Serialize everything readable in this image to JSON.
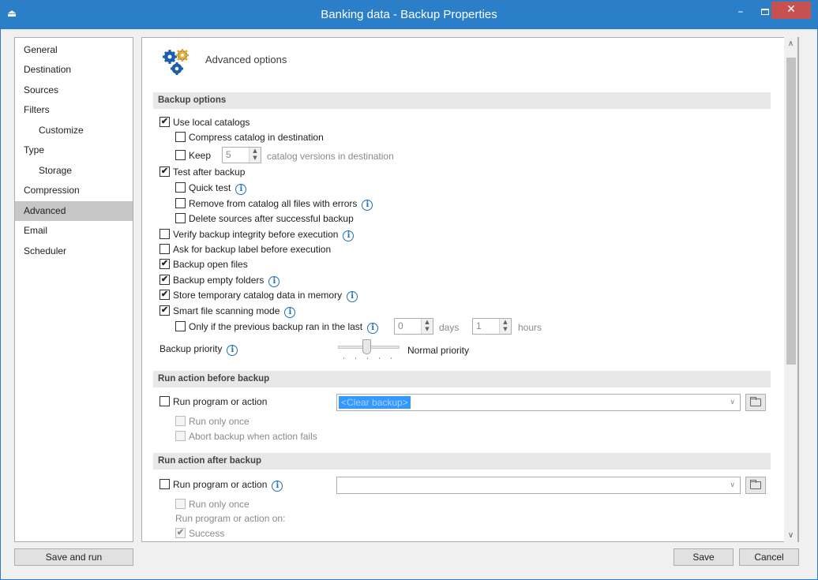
{
  "window": {
    "title": "Banking data - Backup Properties",
    "app_icon": "eject-icon",
    "minimize_glyph": "–",
    "close_glyph": "✕"
  },
  "nav": {
    "items": [
      {
        "label": "General"
      },
      {
        "label": "Destination"
      },
      {
        "label": "Sources"
      },
      {
        "label": "Filters"
      },
      {
        "label": "Customize"
      },
      {
        "label": "Type"
      },
      {
        "label": "Storage"
      },
      {
        "label": "Compression"
      },
      {
        "label": "Advanced"
      },
      {
        "label": "Email"
      },
      {
        "label": "Scheduler"
      }
    ],
    "selected": "Advanced"
  },
  "header": {
    "title": "Advanced options",
    "icon": "gears-icon"
  },
  "backup_options": {
    "title": "Backup options",
    "use_local_catalogs": {
      "label": "Use local catalogs",
      "checked": true
    },
    "compress_catalog": {
      "label": "Compress catalog in destination",
      "checked": false
    },
    "keep": {
      "label": "Keep",
      "checked": false,
      "value": "5",
      "suffix": "catalog versions in destination"
    },
    "test_after_backup": {
      "label": "Test after backup",
      "checked": true
    },
    "quick_test": {
      "label": "Quick test",
      "checked": false
    },
    "remove_from_catalog": {
      "label": "Remove from catalog all files with errors",
      "checked": false
    },
    "delete_sources": {
      "label": "Delete sources after successful backup",
      "checked": false
    },
    "verify_integrity": {
      "label": "Verify backup integrity before execution",
      "checked": false
    },
    "ask_label": {
      "label": "Ask for backup label before execution",
      "checked": false
    },
    "backup_open_files": {
      "label": "Backup open files",
      "checked": true
    },
    "backup_empty_folders": {
      "label": "Backup empty folders",
      "checked": true
    },
    "store_temp_catalog": {
      "label": "Store temporary catalog data in memory",
      "checked": true
    },
    "smart_scanning": {
      "label": "Smart file scanning mode",
      "checked": true
    },
    "only_if_previous": {
      "label": "Only if the previous backup ran in the last",
      "checked": false,
      "days_value": "0",
      "days_label": "days",
      "hours_value": "1",
      "hours_label": "hours"
    },
    "priority": {
      "label": "Backup priority",
      "value_label": "Normal priority",
      "level": 0.5
    }
  },
  "before": {
    "title": "Run action before backup",
    "run_program": {
      "label": "Run program or action",
      "checked": false,
      "combo_value": "<Clear backup>"
    },
    "run_only_once": {
      "label": "Run only once",
      "checked": false
    },
    "abort_on_fail": {
      "label": "Abort backup when action fails",
      "checked": false
    }
  },
  "after": {
    "title": "Run action after backup",
    "run_program": {
      "label": "Run program or action",
      "checked": false,
      "combo_value": ""
    },
    "run_only_once": {
      "label": "Run only once",
      "checked": false
    },
    "run_on_label": "Run program or action on:",
    "success": {
      "label": "Success",
      "checked": true
    }
  },
  "footer": {
    "save_and_run": "Save and run",
    "save": "Save",
    "cancel": "Cancel"
  },
  "info_glyph": "i",
  "check_glyph": "✔"
}
